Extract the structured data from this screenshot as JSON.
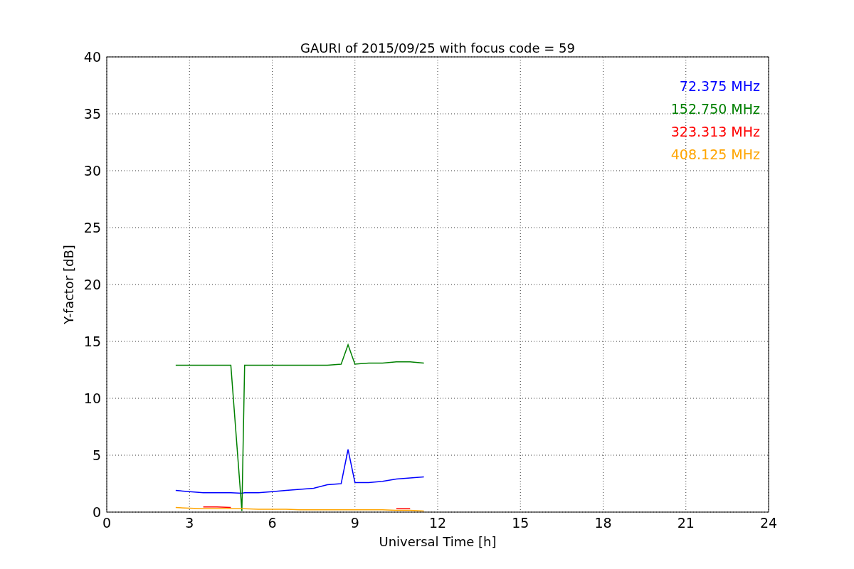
{
  "figure": {
    "chart_data": {
      "type": "line",
      "title": "GAURI of 2015/09/25 with focus code = 59",
      "xlabel": "Universal Time [h]",
      "ylabel": "Y-factor [dB]",
      "x": [
        2.5,
        3,
        3.5,
        4,
        4.5,
        4.9,
        5,
        5.5,
        6,
        6.5,
        7,
        7.5,
        8,
        8.5,
        8.75,
        9,
        9.5,
        10,
        10.5,
        11,
        11.5
      ],
      "series": [
        {
          "name": "72.375 MHz",
          "color": "#0000ff",
          "values": [
            1.9,
            1.8,
            1.7,
            1.7,
            1.7,
            1.65,
            1.7,
            1.7,
            1.8,
            1.9,
            2.0,
            2.1,
            2.4,
            2.5,
            5.5,
            2.6,
            2.6,
            2.7,
            2.9,
            3.0,
            3.1
          ]
        },
        {
          "name": "152.750 MHz",
          "color": "#008000",
          "values": [
            12.9,
            12.9,
            12.9,
            12.9,
            12.9,
            0.1,
            12.9,
            12.9,
            12.9,
            12.9,
            12.9,
            12.9,
            12.9,
            13.0,
            14.7,
            13.0,
            13.1,
            13.1,
            13.2,
            13.2,
            13.1
          ]
        },
        {
          "name": "323.313 MHz",
          "color": "#ff0000",
          "values": [
            null,
            null,
            0.45,
            0.45,
            0.4,
            null,
            null,
            null,
            null,
            null,
            null,
            null,
            null,
            null,
            null,
            null,
            null,
            null,
            0.3,
            0.3,
            null
          ]
        },
        {
          "name": "408.125 MHz",
          "color": "#ffa500",
          "values": [
            0.4,
            0.35,
            0.3,
            0.3,
            0.3,
            0.3,
            0.3,
            0.25,
            0.25,
            0.25,
            0.2,
            0.2,
            0.2,
            0.2,
            0.2,
            0.2,
            0.2,
            0.2,
            0.15,
            0.15,
            0.1
          ]
        }
      ],
      "grid": true,
      "xlim": [
        0,
        24
      ],
      "ylim": [
        0,
        40
      ],
      "xticks": [
        0,
        3,
        6,
        9,
        12,
        15,
        18,
        21,
        24
      ],
      "yticks": [
        0,
        5,
        10,
        15,
        20,
        25,
        30,
        35,
        40
      ]
    }
  }
}
